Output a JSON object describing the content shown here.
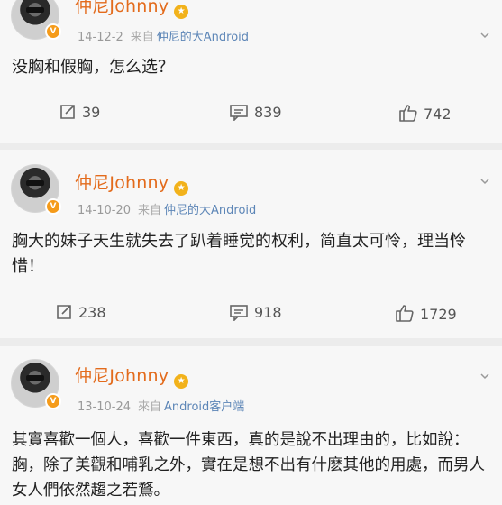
{
  "posts": [
    {
      "author": "仲尼Johnny",
      "date": "14-12-2",
      "from_label": "来自",
      "source": "仲尼的大Android",
      "text": "没胸和假胸，怎么选？",
      "reposts": "39",
      "comments": "839",
      "likes": "742"
    },
    {
      "author": "仲尼Johnny",
      "date": "14-10-20",
      "from_label": "来自",
      "source": "仲尼的大Android",
      "text": "胸大的妹子天生就失去了趴着睡觉的权利，简直太可怜，理当怜惜！",
      "reposts": "238",
      "comments": "918",
      "likes": "1729"
    },
    {
      "author": "仲尼Johnny",
      "date": "13-10-24",
      "from_label": "來自",
      "source": "Android客户端",
      "text": "其實喜歡一個人，喜歡一件東西，真的是說不出理由的，比如說：胸，除了美觀和哺乳之外，實在是想不出有什麽其他的用處，而男人女人們依然趨之若鶩。"
    }
  ],
  "colors": {
    "author": "#e36b1c",
    "source": "#5d86b7",
    "badge": "#f59b1a"
  },
  "icons": {
    "repost": "repost-icon",
    "comment": "comment-icon",
    "like": "thumbs-up-icon"
  }
}
